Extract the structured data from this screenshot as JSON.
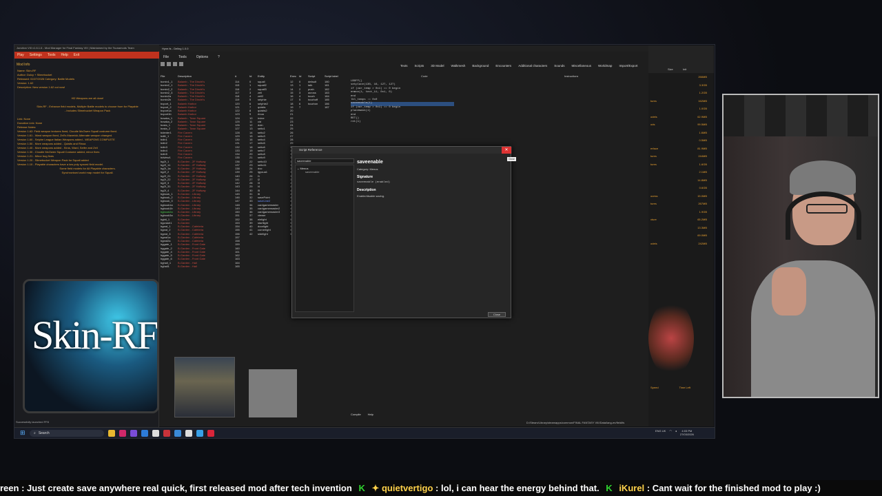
{
  "junction": {
    "title": "Junction VIII v1.6.1.6 - Mod Manager for Final Fantasy VIII | Maintained by the Tsunamods Team",
    "menu": [
      "Play",
      "Settings",
      "Tools",
      "Help",
      "Exit"
    ],
    "mod_info_label": "Mod Info",
    "info_lines": [
      "Name: Skin-RF",
      "Author: Dulcy + Slimebucket",
      "Released: 02/27/2026  Category: Battle Models",
      "Version: 1.62",
      "Description: New version 1.62 out now!"
    ],
    "center_lines": [
      "HD Weapons are all done!",
      "Skin-RF - Enhance field models, Multiple Battle models to choose from for Playable",
      "- Includes Slimebucket Weapon Pack"
    ],
    "link_label": "Link: None",
    "donation_label": "Donation Link: None",
    "release_notes_label": "Release Notes:",
    "release_notes": [
      "Version 1.62: Field weapon textures fixed, Cloudie McOwen Squall costume fixed.",
      "Version 1.61 - Ward weapon fixed, Zell's Maverick Alternate weapon changed.",
      "Version 1.60 - Seiphe League Italian Weapons added - WEAPONS COMPLETE",
      "Version 1.50 - More weapons added - Quistis and Rinoa",
      "Version 1.40 - More weapons added - Kiros, Ward, Seifer and Zell",
      "Version 1.30 - Cloudie McOwen Squall Costume added, minor fixes",
      "Version 1.21 - Minor bug fixes",
      "Version 1.20 - Slimebucket Weapon Pack for Squall added",
      "Version 1.10 - Playable characters have a low poly synced field model.",
      "Some field models for All Playable characters.",
      "Synchronised world map model for Squall."
    ],
    "banner_text": "Skin-RF",
    "status": "Successfully launched FF8"
  },
  "hyne": {
    "title": "Hyne.fs - Deling 1.0.0",
    "menu": [
      "File",
      "Tools",
      "Options",
      "?"
    ],
    "tabs": [
      "Texts",
      "Scripts",
      "3D Model",
      "Walkmesh",
      "Background",
      "Encounters",
      "Additional characters",
      "Sounds",
      "Miscellaneous",
      "Worldmap",
      "Import/Export"
    ],
    "file_headers": [
      "File",
      "Description",
      "#"
    ],
    "files": [
      [
        "bcmin1_1",
        "Balamb - The Dincht's",
        "114"
      ],
      [
        "bcmin2_1",
        "Balamb - The Dincht's",
        "115"
      ],
      [
        "bcmin2_2",
        "Balamb - The Dincht's",
        "116"
      ],
      [
        "bcmin2_3",
        "Balamb - The Dincht's",
        "117"
      ],
      [
        "bcmin2a",
        "Balamb - The Dincht's",
        "118"
      ],
      [
        "bcmin2b",
        "Balamb - The Dincht's",
        "119"
      ],
      [
        "bcport_1",
        "Balamb Harbor",
        "120"
      ],
      [
        "bcport_2",
        "Balamb Harbor",
        "121"
      ],
      [
        "bcport1a",
        "Balamb Harbor",
        "122"
      ],
      [
        "bcport1b",
        "Balamb Harbor",
        "123"
      ],
      [
        "bcsaka_1",
        "Balamb - Town Square",
        "124"
      ],
      [
        "bcsaka_2",
        "Balamb - Town Square",
        "125"
      ],
      [
        "bcsta_1",
        "Balamb - Town Square",
        "126"
      ],
      [
        "bcsta_2",
        "Balamb - Town Square",
        "127"
      ],
      [
        "bdenter1",
        "Fire Cavern",
        "128"
      ],
      [
        "bdifr_1",
        "Fire Cavern",
        "129"
      ],
      [
        "bdin1",
        "Fire Cavern",
        "130"
      ],
      [
        "bdin2",
        "Fire Cavern",
        "131"
      ],
      [
        "bdin3",
        "Fire Cavern",
        "132"
      ],
      [
        "bdin4",
        "Fire Cavern",
        "133"
      ],
      [
        "bdin5",
        "Fire Cavern",
        "134"
      ],
      [
        "bdview1",
        "Fire Cavern",
        "135"
      ],
      [
        "bg2f_1",
        "B-Garden - 2F Hallway",
        "136"
      ],
      [
        "bg2f_11",
        "B-Garden - 2F Hallway",
        "137"
      ],
      [
        "bg2f_1a",
        "B-Garden - 2F Hallway",
        "138"
      ],
      [
        "bg2f_2",
        "B-Garden - 2F Hallway",
        "139"
      ],
      [
        "bg2f_21",
        "B-Garden - 2F Hallway",
        "140"
      ],
      [
        "bg2f_22",
        "B-Garden - 2F Hallway",
        "141"
      ],
      [
        "bg2f_3",
        "B-Garden - 2F Hallway",
        "142"
      ],
      [
        "bg2f_31",
        "B-Garden - 2F Hallway",
        "143"
      ],
      [
        "bg2f_4",
        "B-Garden - 2F Hallway",
        "144"
      ],
      [
        "bgbook_1",
        "B-Garden - Library",
        "145"
      ],
      [
        "bgbook_2",
        "B-Garden - Library",
        "146"
      ],
      [
        "bgbook_3",
        "B-Garden - Library",
        "147"
      ],
      [
        "bgbook1a",
        "B-Garden - Library",
        "148"
      ],
      [
        "bgbook1b",
        "B-Garden - Library",
        "149"
      ],
      [
        "bgbook2a",
        "B-Garden - Library",
        "150"
      ],
      [
        "bgbook3a",
        "B-Garden - Library",
        "151"
      ],
      [
        "bgbtl_1",
        "B-Garden",
        "152"
      ],
      [
        "bgcrash1",
        "B-Garden",
        "153"
      ],
      [
        "bgeat_1",
        "B-Garden - Cafeteria",
        "154"
      ],
      [
        "bgeat_2",
        "B-Garden - Cafeteria",
        "155"
      ],
      [
        "bgeat_3",
        "B-Garden - Cafeteria",
        "156"
      ],
      [
        "bgeat1a",
        "B-Garden - Cafeteria",
        "157"
      ],
      [
        "bgeat2a",
        "B-Garden - Cafeteria",
        "158"
      ],
      [
        "bggate_1",
        "B-Garden - Front Gate",
        "159"
      ],
      [
        "bggate_2",
        "B-Garden - Front Gate",
        "160"
      ],
      [
        "bggate_4",
        "B-Garden - Front Gate",
        "161"
      ],
      [
        "bggate_5",
        "B-Garden - Front Gate",
        "162"
      ],
      [
        "bggate_6",
        "B-Garden - Front Gate",
        "163"
      ],
      [
        "bghall_1",
        "B-Garden - Hall",
        "164"
      ],
      [
        "bghall1",
        "B-Garden - Hall",
        "165"
      ]
    ],
    "entity_headers": [
      "Id",
      "Entity",
      "Exec"
    ],
    "entities": [
      [
        "0",
        "squall",
        "12"
      ],
      [
        "1",
        "squall2",
        "13"
      ],
      [
        "2",
        "squall3",
        "14"
      ],
      [
        "3",
        "zell",
        "15"
      ],
      [
        "4",
        "zell2",
        "16"
      ],
      [
        "5",
        "selphie",
        "17"
      ],
      [
        "6",
        "selphie2",
        "18"
      ],
      [
        "7",
        "quistis",
        "19"
      ],
      [
        "8",
        "quistis2",
        "20"
      ],
      [
        "9",
        "rinoa",
        "21"
      ],
      [
        "10",
        "irvine",
        "22"
      ],
      [
        "11",
        "cid",
        "23"
      ],
      [
        "12",
        "doin",
        "24"
      ],
      [
        "13",
        "seito1",
        "25"
      ],
      [
        "14",
        "seito2",
        "26"
      ],
      [
        "15",
        "seito3",
        "27"
      ],
      [
        "16",
        "seito4",
        "28"
      ],
      [
        "17",
        "seito5",
        "29"
      ],
      [
        "18",
        "seito6",
        "30"
      ],
      [
        "19",
        "seito7",
        "31"
      ],
      [
        "20",
        "seito8",
        "32"
      ],
      [
        "21",
        "seito9",
        "33"
      ],
      [
        "22",
        "seito10",
        "34"
      ],
      [
        "23",
        "seito11",
        "35"
      ],
      [
        "24",
        "doc",
        "36"
      ],
      [
        "25",
        "igyoua1",
        "37"
      ],
      [
        "26",
        "l1",
        "38"
      ],
      [
        "27",
        "l2",
        "39"
      ],
      [
        "28",
        "l3",
        "40"
      ],
      [
        "29",
        "l4",
        "41"
      ],
      [
        "30",
        "l5",
        "42"
      ],
      [
        "31",
        "l6",
        "43"
      ],
      [
        "32",
        "savePoint",
        "44"
      ],
      [
        "33",
        "saveLine2",
        "45"
      ],
      [
        "34",
        "cardgamemaster",
        "46"
      ],
      [
        "35",
        "cardgamemaster2",
        "47"
      ],
      [
        "36",
        "cardgamemaster3",
        "48"
      ],
      [
        "37",
        "viewer",
        "49"
      ],
      [
        "38",
        "elelight",
        "50"
      ],
      [
        "39",
        "startlight",
        "51"
      ],
      [
        "40",
        "doorlight",
        "52"
      ],
      [
        "41",
        "cornerlight",
        "53"
      ],
      [
        "42",
        "sidelight",
        "54"
      ]
    ],
    "script_headers": [
      "Id",
      "Script",
      "Script label"
    ],
    "scripts": [
      [
        "0",
        "",
        "180"
      ],
      [
        "1",
        "default",
        "181"
      ],
      [
        "2",
        "talk",
        "182"
      ],
      [
        "3",
        "push",
        "183"
      ],
      [
        "4",
        "across",
        "184"
      ],
      [
        "5",
        "touch",
        "185"
      ],
      [
        "6",
        "touchoff",
        "186"
      ],
      [
        "7",
        "touchon",
        "187"
      ]
    ],
    "code_header": "Code",
    "instructions_header": "Instructions",
    "code_lines": [
      "LBOFF()",
      "setplace(130, 16, 127, 127)",
      "if (var_temp > 0x1) == 0 begin",
      "  enmov(1, text_11, 0x1, 0)",
      "end",
      "lbl_temps := 0x0",
      "saveenable(1)",
      "if (var_temp > 0x1) == 0 begin",
      "  placemask(1)",
      "end",
      "RET()",
      "ret(1)"
    ],
    "bottom_tabs": [
      "Compile",
      "Help"
    ],
    "path": "D:/Steam/Library/steamapps/common/FINAL FANTASY VIII/Data/lang-en/field/fs"
  },
  "dialog": {
    "title": "Script Reference",
    "search_value": "saveenable",
    "tree_group": "Menus",
    "tree_item": "saveenable",
    "name": "saveenable",
    "category": "Category: Menus",
    "signature_label": "Signature",
    "signature": "saveenable (enabled)",
    "description_label": "Description",
    "description": "Enable/disable saving.",
    "close_label": "Close",
    "close_x": "✕",
    "tooltip": "Close"
  },
  "right_panel": {
    "headers": [
      "Size",
      "Init"
    ],
    "rows": [
      [
        "",
        "266MB"
      ],
      [
        "",
        "3.3GB"
      ],
      [
        "",
        "1.2GB"
      ],
      [
        "tures",
        "162MB"
      ],
      [
        "",
        "1.0GB"
      ],
      [
        "odels",
        "62.9MB"
      ],
      [
        "ods",
        "99.5MB"
      ],
      [
        "",
        "1.6MB"
      ],
      [
        "",
        "0.5MB"
      ],
      [
        "erface",
        "81.9MB"
      ],
      [
        "tures",
        "244MB"
      ],
      [
        "tures",
        "1.6GB"
      ],
      [
        "",
        "2.1MB"
      ],
      [
        "",
        "14.8MB"
      ],
      [
        "",
        "0.6GB"
      ],
      [
        "ocess",
        "15.0MB"
      ],
      [
        "tures",
        "267MB"
      ],
      [
        "",
        "1.9GB"
      ],
      [
        "xture",
        "65.2MB"
      ],
      [
        "",
        "13.3MB"
      ],
      [
        "",
        "69.0MB"
      ],
      [
        "odels",
        "242MB"
      ]
    ],
    "speed_label": "Speed",
    "time_left_label": "Time Left"
  },
  "taskbar": {
    "search_label": "Search",
    "lang": "ENG UK",
    "time": "4:03 PM",
    "date": "27/03/2026"
  },
  "ticker": {
    "segments": [
      {
        "type": "text",
        "text": "reen : Just create save anywhere real quick, first released mod after tech invention"
      },
      {
        "type": "user",
        "text": "quietvertigo"
      },
      {
        "type": "text",
        "text": ": lol, i can hear the energy behind that."
      },
      {
        "type": "user",
        "text": "iKurel"
      },
      {
        "type": "text",
        "text": ": Cant wait for the finished mod to play :)"
      }
    ]
  }
}
